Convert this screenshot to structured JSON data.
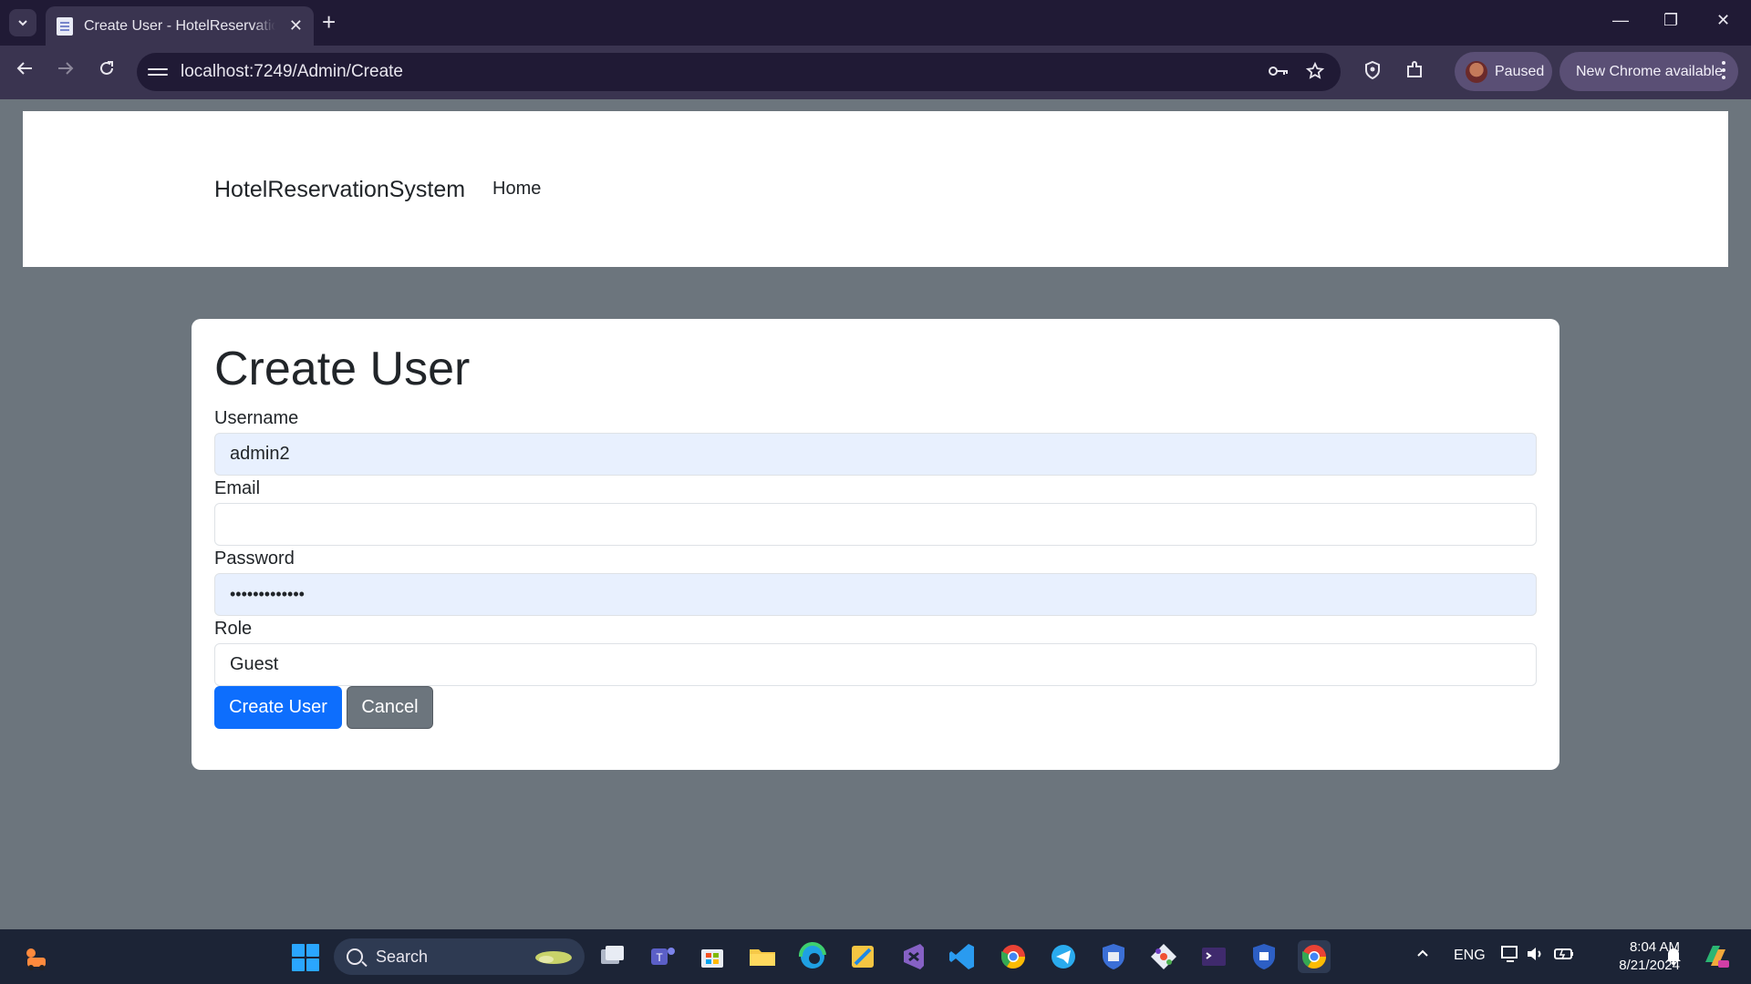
{
  "browser": {
    "tab_title": "Create User - HotelReservationSystem",
    "tab_close": "✕",
    "new_tab": "+",
    "url": "localhost:7249/Admin/Create",
    "profile_label": "Paused",
    "update_label": "New Chrome available"
  },
  "window_controls": {
    "minimize": "—",
    "restore": "❐",
    "close": "✕"
  },
  "site": {
    "brand": "HotelReservationSystem",
    "nav_home": "Home"
  },
  "form": {
    "title": "Create User",
    "username_label": "Username",
    "username_value": "admin2",
    "email_label": "Email",
    "email_value": "",
    "password_label": "Password",
    "password_value": "•••••••••••••",
    "role_label": "Role",
    "role_value": "Guest",
    "submit_label": "Create User",
    "cancel_label": "Cancel"
  },
  "taskbar": {
    "search_label": "Search",
    "language": "ENG",
    "time": "8:04 AM",
    "date": "8/21/2024"
  },
  "colors": {
    "primary": "#0d6efd",
    "secondary": "#6c757d",
    "autofill": "#e8f0fe",
    "browser_frame": "#201a35"
  }
}
